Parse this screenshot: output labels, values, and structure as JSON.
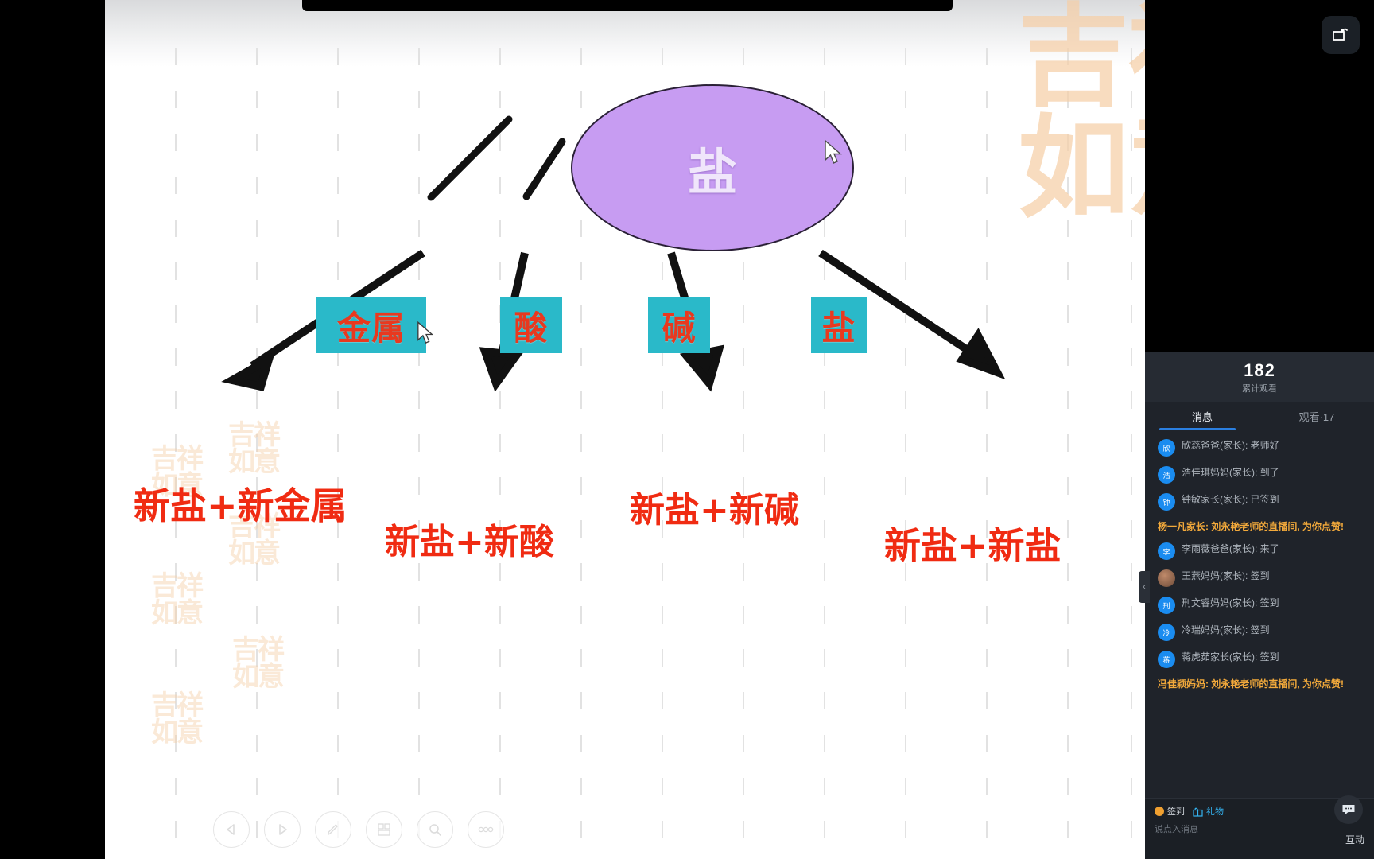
{
  "slide": {
    "watermark_text": "吉祥如意",
    "root_node": {
      "label": "盐"
    },
    "category_nodes": [
      {
        "label": "金属"
      },
      {
        "label": "酸"
      },
      {
        "label": "碱"
      },
      {
        "label": "盐"
      }
    ],
    "result_labels": [
      {
        "text": "新盐+新金属"
      },
      {
        "text": "新盐+新酸"
      },
      {
        "text": "新盐+新碱"
      },
      {
        "text": "新盐+新盐"
      }
    ],
    "colors": {
      "node_fill": "#c79cf2",
      "node_text": "#f0e6fb",
      "box_fill": "#2ab9c9",
      "box_text": "#e8391f",
      "result_text": "#f02b12",
      "watermark": "#f6cfa7"
    }
  },
  "toolbar": {
    "buttons": [
      {
        "name": "prev-slide",
        "icon": "triangle-left-icon"
      },
      {
        "name": "next-slide",
        "icon": "triangle-right-icon"
      },
      {
        "name": "pen-tool",
        "icon": "pen-icon"
      },
      {
        "name": "slide-thumbnails",
        "icon": "layout-grid-icon"
      },
      {
        "name": "zoom-tool",
        "icon": "magnifier-icon"
      },
      {
        "name": "more-options",
        "icon": "more-dots-icon"
      }
    ]
  },
  "pip_button": {
    "icon": "picture-in-picture-icon"
  },
  "chat": {
    "view_count": "182",
    "view_count_label": "累计观看",
    "tabs": [
      {
        "label": "消息",
        "active": true
      },
      {
        "label": "观看·17",
        "active": false
      }
    ],
    "messages": [
      {
        "avatar_text": "欣",
        "text": "欣蕊爸爸(家长): 老师好",
        "highlight": false,
        "photo": false
      },
      {
        "avatar_text": "浩",
        "text": "浩佳琪妈妈(家长): 到了",
        "highlight": false,
        "photo": false
      },
      {
        "avatar_text": "钟",
        "text": "钟敏家长(家长): 已签到",
        "highlight": false,
        "photo": false
      },
      {
        "avatar_text": "",
        "text": "杨一凡家长: 刘永艳老师的直播间, 为你点赞!",
        "highlight": true,
        "photo": false
      },
      {
        "avatar_text": "李",
        "text": "李雨薇爸爸(家长): 来了",
        "highlight": false,
        "photo": false
      },
      {
        "avatar_text": "",
        "text": "王燕妈妈(家长): 签到",
        "highlight": false,
        "photo": true
      },
      {
        "avatar_text": "刑",
        "text": "刑文睿妈妈(家长): 签到",
        "highlight": false,
        "photo": false
      },
      {
        "avatar_text": "冷",
        "text": "冷瑞妈妈(家长): 签到",
        "highlight": false,
        "photo": false
      },
      {
        "avatar_text": "蒋",
        "text": "蒋虎茹家长(家长): 签到",
        "highlight": false,
        "photo": false
      },
      {
        "avatar_text": "",
        "text": "冯佳颖妈妈: 刘永艳老师的直播间, 为你点赞!",
        "highlight": true,
        "photo": false
      }
    ],
    "footer": {
      "signin_label": "签到",
      "gift_label": "礼物",
      "input_placeholder": "说点入消息",
      "interaction_label": "互动",
      "bubble_icon": "chat-bubble-icon"
    },
    "collapse_icon": "chevron-left-icon"
  }
}
